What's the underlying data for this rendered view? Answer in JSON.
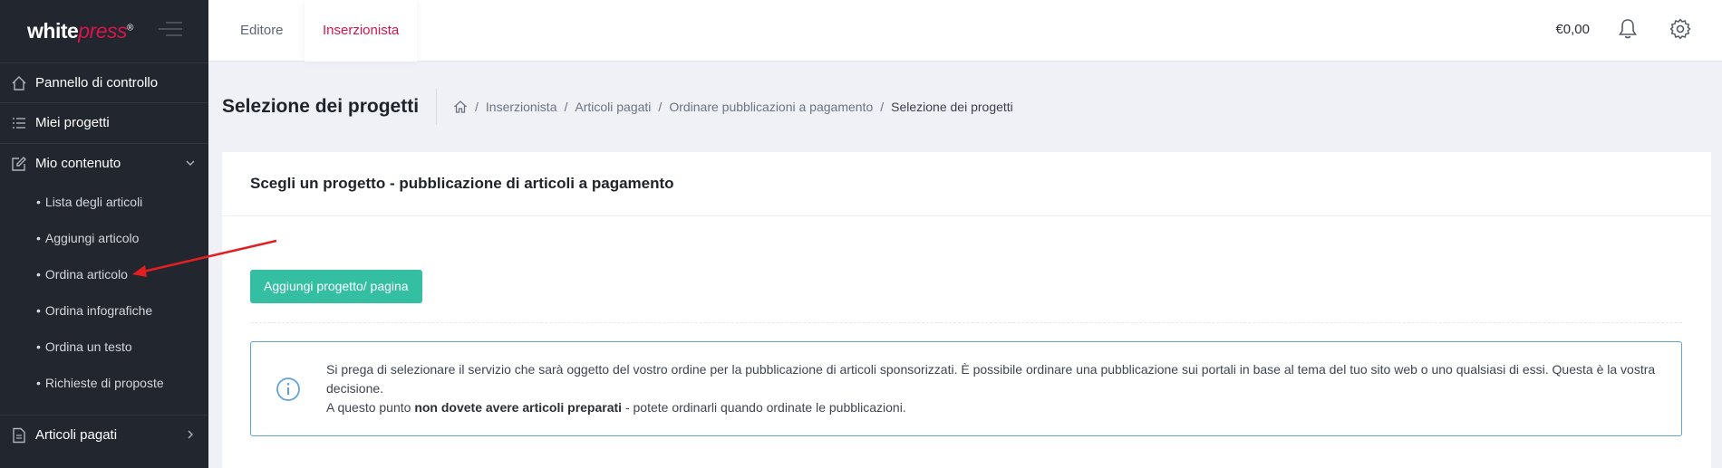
{
  "brand": {
    "name_bold": "white",
    "name_italic": "press",
    "mark": "®"
  },
  "topbar": {
    "tabs": [
      {
        "label": "Editore"
      },
      {
        "label": "Inserzionista"
      }
    ],
    "balance": "€0,00",
    "icons": [
      "bell-icon",
      "gear-icon"
    ]
  },
  "sidebar": {
    "items": [
      {
        "label": "Pannello di controllo",
        "icon": "home-icon"
      },
      {
        "label": "Miei progetti",
        "icon": "list-icon"
      },
      {
        "label": "Mio contenuto",
        "icon": "edit-icon",
        "expanded": true
      },
      {
        "label": "Articoli pagati",
        "icon": "document-icon"
      }
    ],
    "sub_items": [
      {
        "label": "Lista degli articoli"
      },
      {
        "label": "Aggiungi articolo"
      },
      {
        "label": "Ordina articolo"
      },
      {
        "label": "Ordina infografiche"
      },
      {
        "label": "Ordina un testo"
      },
      {
        "label": "Richieste di proposte"
      }
    ]
  },
  "page": {
    "title": "Selezione dei progetti",
    "breadcrumb": [
      {
        "label": "Inserzionista"
      },
      {
        "label": "Articoli pagati"
      },
      {
        "label": "Ordinare pubblicazioni a pagamento"
      },
      {
        "label": "Selezione dei progetti"
      }
    ]
  },
  "card": {
    "title": "Scegli un progetto - pubblicazione di articoli a pagamento",
    "add_button": "Aggiungi progetto/ pagina",
    "info": {
      "line1": "Si prega di selezionare il servizio che sarà oggetto del vostro ordine per la pubblicazione di articoli sponsorizzati. È possibile ordinare una pubblicazione sui portali in base al tema del tuo sito web o uno qualsiasi di essi. Questa è la vostra decisione.",
      "line2_pre": "A questo punto ",
      "line2_bold": "non dovete avere articoli preparati",
      "line2_post": " - potete ordinarli quando ordinate le pubblicazioni."
    }
  },
  "colors": {
    "sidebar_bg": "#22262e",
    "accent": "#d4174a",
    "button": "#34bfa3",
    "info_border": "#5fa3de",
    "arrow": "#e02020"
  }
}
